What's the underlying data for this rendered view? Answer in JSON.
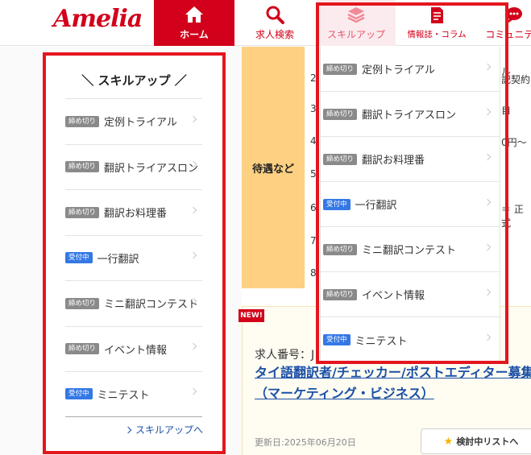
{
  "header": {
    "logo": "Amelia",
    "nav": [
      {
        "label": "ホーム"
      },
      {
        "label": "求人検索"
      },
      {
        "label": "スキルアップ"
      },
      {
        "label": "情報誌・コラム"
      },
      {
        "label": "コミュニティ"
      }
    ]
  },
  "table": {
    "row_label": "待遇など",
    "numbers": [
      "2",
      "3",
      "4",
      "5",
      "6",
      "7",
      "8"
    ],
    "fragments": [
      "ル",
      "記契約",
      "自",
      "0円〜",
      "＝ 正式"
    ]
  },
  "job": {
    "new_badge": "NEW!",
    "id_label": "求人番号：J",
    "title": "タイ語翻訳者/チェッカー/ポストエディター募集（マーケティング・ビジネス）",
    "updated": "更新日:2025年06月20日",
    "wishlist_button": "検討中リストへ"
  },
  "sidebar": {
    "title": "＼ スキルアップ ／",
    "items": [
      {
        "badge": "締め切り",
        "status": "closed",
        "label": "定例トライアル"
      },
      {
        "badge": "締め切り",
        "status": "closed",
        "label": "翻訳トライアスロン"
      },
      {
        "badge": "締め切り",
        "status": "closed",
        "label": "翻訳お料理番"
      },
      {
        "badge": "受付中",
        "status": "open",
        "label": "一行翻訳"
      },
      {
        "badge": "締め切り",
        "status": "closed",
        "label": "ミニ翻訳コンテスト"
      },
      {
        "badge": "締め切り",
        "status": "closed",
        "label": "イベント情報"
      },
      {
        "badge": "受付中",
        "status": "open",
        "label": "ミニテスト"
      }
    ],
    "more_link": "スキルアップへ"
  },
  "dropdown": {
    "items": [
      {
        "badge": "締め切り",
        "status": "closed",
        "label": "定例トライアル"
      },
      {
        "badge": "締め切り",
        "status": "closed",
        "label": "翻訳トライアスロン"
      },
      {
        "badge": "締め切り",
        "status": "closed",
        "label": "翻訳お料理番"
      },
      {
        "badge": "受付中",
        "status": "open",
        "label": "一行翻訳"
      },
      {
        "badge": "締め切り",
        "status": "closed",
        "label": "ミニ翻訳コンテスト"
      },
      {
        "badge": "締め切り",
        "status": "closed",
        "label": "イベント情報"
      },
      {
        "badge": "受付中",
        "status": "open",
        "label": "ミニテスト"
      }
    ]
  },
  "colors": {
    "brand_red": "#d2001a",
    "highlight_red": "#e3161e",
    "badge_closed": "#8a8a8a",
    "badge_open": "#3478e6",
    "link_blue": "#1a4fa5",
    "orange_cell": "#fdd082"
  },
  "icons": {
    "home": "home-icon",
    "search": "search-icon",
    "skill": "layers-icon",
    "info": "document-icon",
    "community": "chat-icon"
  }
}
